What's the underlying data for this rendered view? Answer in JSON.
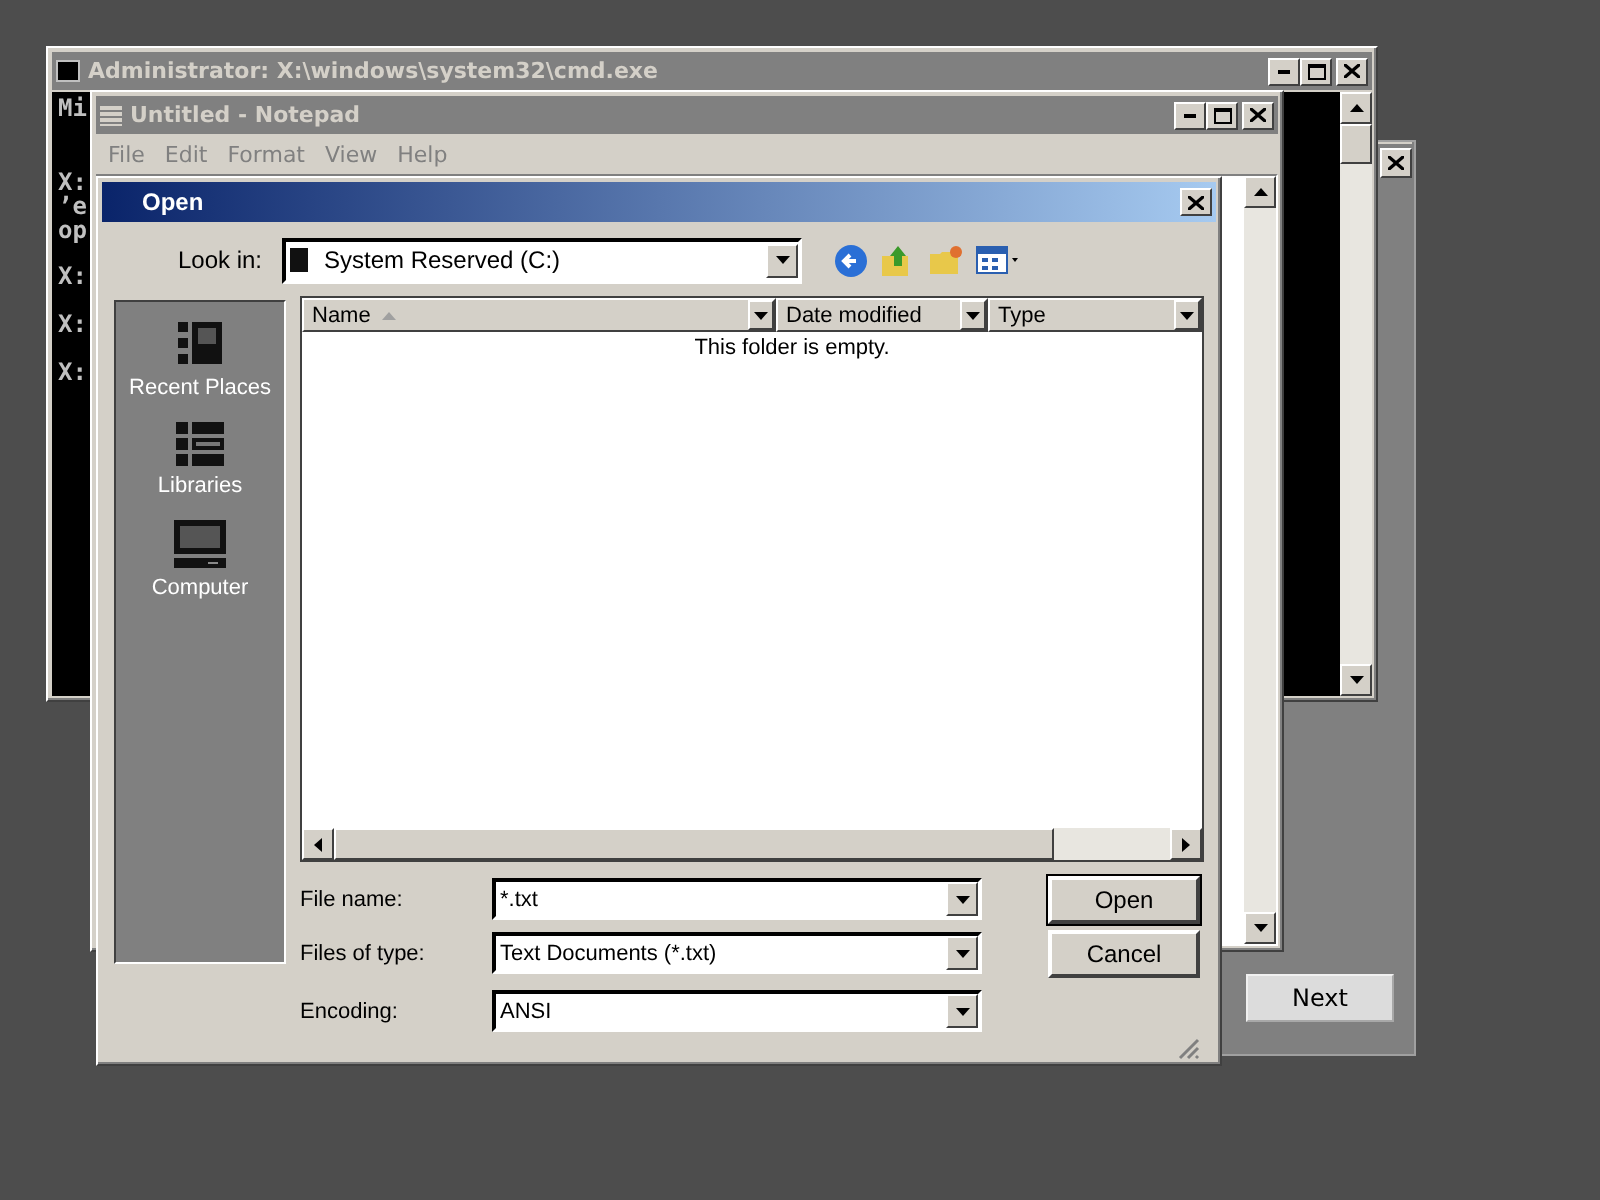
{
  "setup_window": {
    "next_button": "Next"
  },
  "cmd_window": {
    "title": "Administrator: X:\\windows\\system32\\cmd.exe",
    "active": false,
    "lines": [
      "Mi",
      "X:",
      "’e",
      "op",
      "X:",
      "X:",
      "X:"
    ]
  },
  "notepad_window": {
    "title": "Untitled - Notepad",
    "active": false,
    "menu": [
      "File",
      "Edit",
      "Format",
      "View",
      "Help"
    ]
  },
  "open_dialog": {
    "title": "Open",
    "active": true,
    "look_in_label": "Look in:",
    "look_in_value": "System Reserved (C:)",
    "places": [
      {
        "kind": "recent",
        "label": "Recent Places"
      },
      {
        "kind": "libraries",
        "label": "Libraries"
      },
      {
        "kind": "computer",
        "label": "Computer"
      }
    ],
    "columns": [
      {
        "label": "Name",
        "sorted": true
      },
      {
        "label": "Date modified",
        "sorted": false
      },
      {
        "label": "Type",
        "sorted": false
      }
    ],
    "empty_message": "This folder is empty.",
    "fields": [
      {
        "label": "File name:",
        "value": "*.txt"
      },
      {
        "label": "Files of type:",
        "value": "Text Documents (*.txt)"
      },
      {
        "label": "Encoding:",
        "value": "ANSI"
      }
    ],
    "buttons": [
      {
        "label": "Open",
        "default": true
      },
      {
        "label": "Cancel",
        "default": false
      }
    ]
  }
}
